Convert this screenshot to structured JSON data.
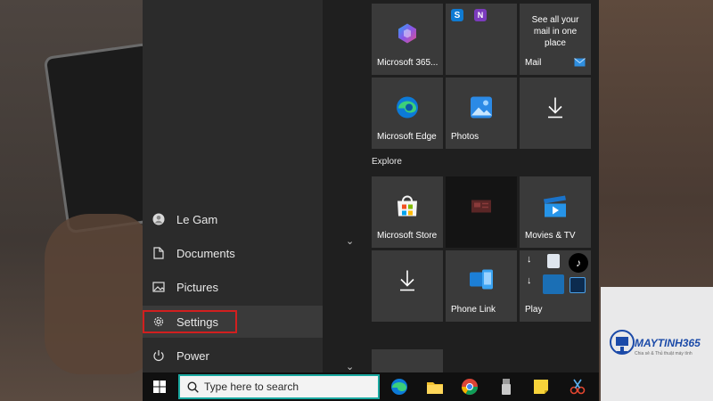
{
  "left_nav": {
    "items": [
      {
        "label": "Le Gam",
        "icon": "user-icon"
      },
      {
        "label": "Documents",
        "icon": "document-icon"
      },
      {
        "label": "Pictures",
        "icon": "pictures-icon"
      },
      {
        "label": "Settings",
        "icon": "gear-icon"
      },
      {
        "label": "Power",
        "icon": "power-icon"
      }
    ]
  },
  "tiles": {
    "microsoft365": "Microsoft 365...",
    "mail_blurb": "See all your mail in one place",
    "mail": "Mail",
    "edge": "Microsoft Edge",
    "photos": "Photos",
    "store": "Microsoft Store",
    "movies": "Movies & TV",
    "phonelink": "Phone Link",
    "play": "Play"
  },
  "sections": {
    "explore": "Explore"
  },
  "taskbar": {
    "search_placeholder": "Type here to search"
  },
  "watermark": {
    "brand": "MAYTINH365",
    "tagline": "Chia sẻ & Thủ thuật máy tính"
  },
  "colors": {
    "highlight": "#d21f1f",
    "search_border": "#1aa8a0",
    "menu_bg": "#1f1f1f",
    "tile_bg": "#3a3a3a"
  }
}
